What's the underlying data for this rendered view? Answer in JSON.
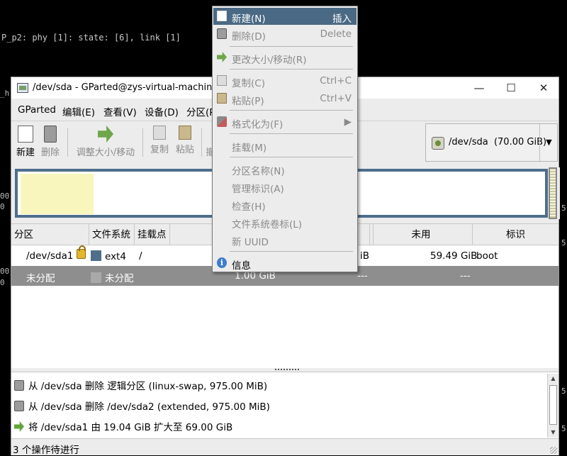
{
  "terminal": {
    "line": "P_p2: phy [1]: state: [6], link [1]",
    "edge_marks": [
      "_h",
      "00",
      "0",
      "00",
      "0",
      "5",
      "5",
      "5",
      "5"
    ]
  },
  "window": {
    "title": "/dev/sda - GParted@zys-virtual-machine",
    "controls": {
      "minimize": "—",
      "maximize": "☐",
      "close": "✕"
    }
  },
  "menubar": {
    "items": [
      "GParted",
      "编辑(E)",
      "查看(V)",
      "设备(D)",
      "分区(P"
    ]
  },
  "toolbar": {
    "new": "新建",
    "delete": "删除",
    "resize": "调整大小/移动",
    "copy": "复制",
    "paste": "粘贴",
    "partial": "撤"
  },
  "device_selector": {
    "label": "/dev/sda",
    "size": "(70.00 GiB)"
  },
  "partition_table": {
    "headers": [
      "分区",
      "文件系统",
      "挂载点",
      "",
      "",
      "未用",
      "标识"
    ],
    "rows": [
      {
        "partition": "/dev/sda1",
        "filesystem": "ext4",
        "fs_color": "#4f6e8c",
        "mountpoint": "/",
        "size": "",
        "used": "iB",
        "unused": "59.49 GiB",
        "flags": "boot",
        "locked": true
      },
      {
        "partition": "未分配",
        "filesystem": "未分配",
        "fs_color": "#a9a9a9",
        "mountpoint": "",
        "size": "1.00 GiB",
        "used": "---",
        "unused": "---",
        "flags": "",
        "locked": false
      }
    ]
  },
  "operations": [
    {
      "icon": "trash-icon",
      "text": "从 /dev/sda 删除 逻辑分区 (linux-swap, 975.00 MiB)"
    },
    {
      "icon": "trash-icon",
      "text": "从 /dev/sda 删除 /dev/sda2 (extended, 975.00 MiB)"
    },
    {
      "icon": "resize-arrow-icon",
      "text": "将 /dev/sda1 由 19.04 GiB 扩大至 69.00 GiB"
    }
  ],
  "status": "3 个操作待进行",
  "context_menu": {
    "items": [
      {
        "label": "新建(N)",
        "accel": "插入",
        "icon": "new-document-icon",
        "enabled": true,
        "highlighted": true
      },
      {
        "label": "删除(D)",
        "accel": "Delete",
        "icon": "trash-icon",
        "enabled": false
      },
      {
        "label": "更改大小/移动(R)",
        "accel": "",
        "icon": "resize-arrow-icon",
        "enabled": false
      },
      {
        "label": "复制(C)",
        "accel": "Ctrl+C",
        "icon": "copy-icon",
        "enabled": false
      },
      {
        "label": "粘贴(P)",
        "accel": "Ctrl+V",
        "icon": "paste-icon",
        "enabled": false
      },
      {
        "label": "格式化为(F)",
        "accel": "▶",
        "icon": "format-icon",
        "enabled": false
      },
      {
        "label": "挂载(M)",
        "accel": "",
        "icon": "",
        "enabled": false
      },
      {
        "label": "分区名称(N)",
        "accel": "",
        "icon": "",
        "enabled": false
      },
      {
        "label": "管理标识(A)",
        "accel": "",
        "icon": "",
        "enabled": false
      },
      {
        "label": "检查(H)",
        "accel": "",
        "icon": "",
        "enabled": false
      },
      {
        "label": "文件系统卷标(L)",
        "accel": "",
        "icon": "",
        "enabled": false
      },
      {
        "label": "新 UUID",
        "accel": "",
        "icon": "",
        "enabled": false
      },
      {
        "label": "信息",
        "accel": "",
        "icon": "info-icon",
        "enabled": true
      }
    ]
  }
}
